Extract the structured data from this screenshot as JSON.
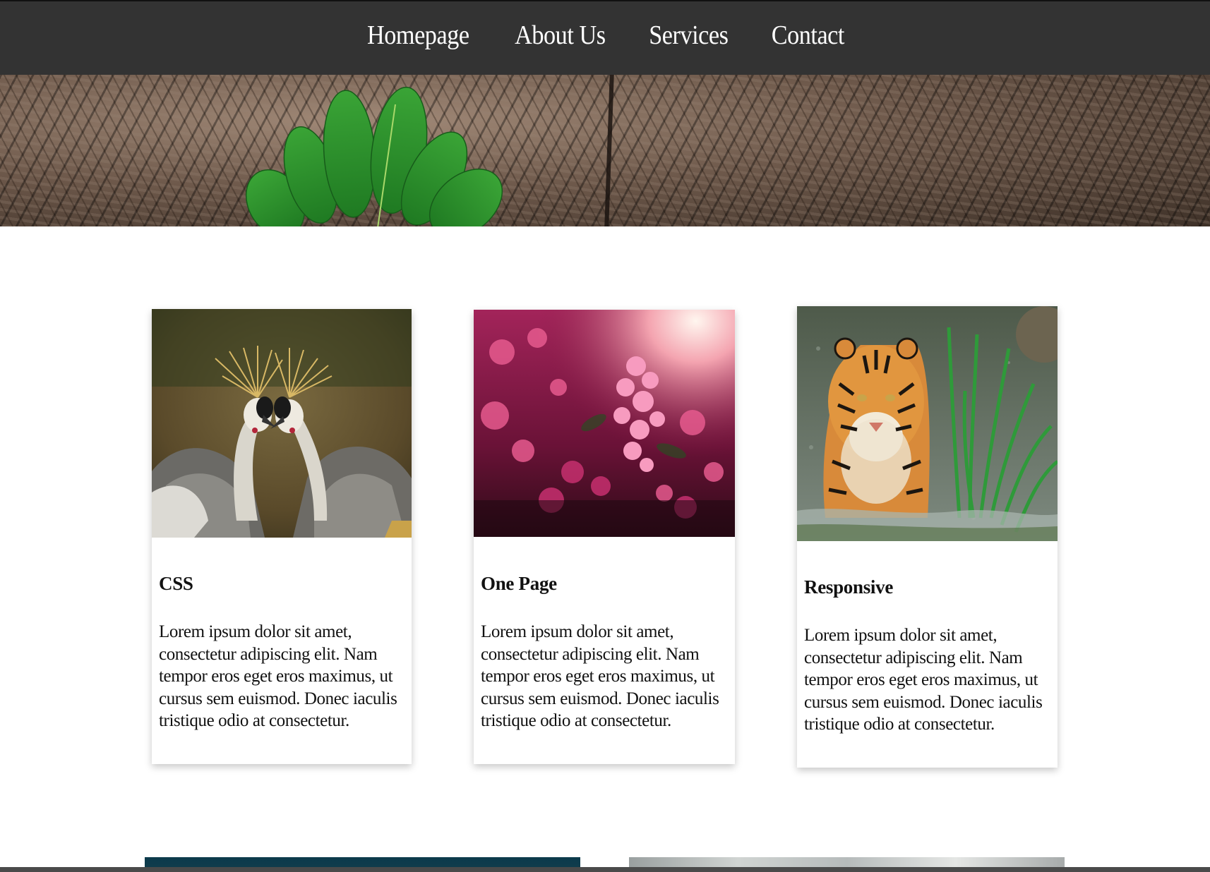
{
  "nav": {
    "items": [
      {
        "label": "Homepage"
      },
      {
        "label": "About Us"
      },
      {
        "label": "Services"
      },
      {
        "label": "Contact"
      }
    ]
  },
  "hero": {
    "image": "tree-bark-with-green-leaf"
  },
  "cards": [
    {
      "image": "crowned-cranes-photo",
      "title": "CSS",
      "text": "Lorem ipsum dolor sit amet, consectetur adipiscing elit. Nam tempor eros eget eros maximus, ut cursus sem euismod. Donec iaculis tristique odio at consectetur."
    },
    {
      "image": "pink-flowers-photo",
      "title": "One Page",
      "text": "Lorem ipsum dolor sit amet, consectetur adipiscing elit. Nam tempor eros eget eros maximus, ut cursus sem euismod. Donec iaculis tristique odio at consectetur."
    },
    {
      "image": "tiger-in-water-photo",
      "title": "Responsive",
      "text": "Lorem ipsum dolor sit amet, consectetur adipiscing elit. Nam tempor eros eget eros maximus, ut cursus sem euismod. Donec iaculis tristique odio at consectetur."
    }
  ],
  "colors": {
    "nav_bg": "#333333",
    "nav_text": "#ffffff",
    "page_bg": "#ffffff",
    "text": "#111111"
  }
}
